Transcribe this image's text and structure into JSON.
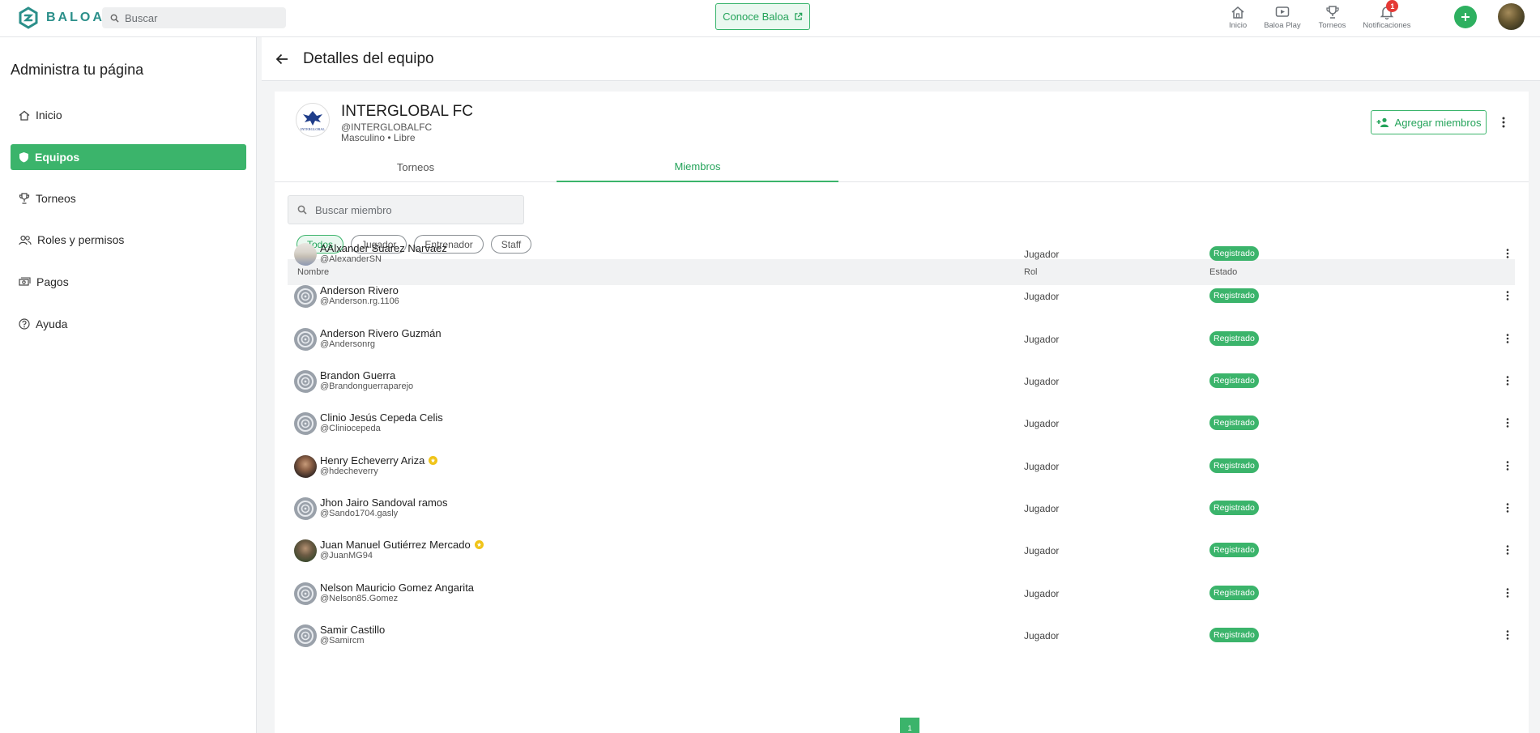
{
  "brand": {
    "name": "BALOA",
    "accent": "#3bb46b",
    "logo_color": "#2b8f8a"
  },
  "topbar": {
    "search_placeholder": "Buscar",
    "conoce_label": "Conoce Baloa",
    "nav": [
      {
        "label": "Inicio",
        "icon": "home-icon"
      },
      {
        "label": "Baloa Play",
        "icon": "play-icon"
      },
      {
        "label": "Torneos",
        "icon": "trophy-icon"
      },
      {
        "label": "Notificaciones",
        "icon": "bell-icon",
        "badge": "1"
      }
    ]
  },
  "sidebar": {
    "title": "Administra tu página",
    "items": [
      {
        "label": "Inicio",
        "icon": "home-icon",
        "active": false
      },
      {
        "label": "Equipos",
        "icon": "shield-icon",
        "active": true
      },
      {
        "label": "Torneos",
        "icon": "trophy-icon",
        "active": false
      },
      {
        "label": "Roles y permisos",
        "icon": "people-icon",
        "active": false
      },
      {
        "label": "Pagos",
        "icon": "money-icon",
        "active": false
      },
      {
        "label": "Ayuda",
        "icon": "help-icon",
        "active": false
      }
    ]
  },
  "header": {
    "title": "Detalles del equipo"
  },
  "team": {
    "name": "INTERGLOBAL FC",
    "handle": "@INTERGLOBALFC",
    "category": "Masculino • Libre",
    "logo_text": "INTERGLOBAL",
    "add_members_label": "Agregar miembros"
  },
  "tabs": [
    {
      "label": "Torneos",
      "active": false
    },
    {
      "label": "Miembros",
      "active": true
    }
  ],
  "members": {
    "search_placeholder": "Buscar miembro",
    "filters": [
      {
        "label": "Todos",
        "active": true
      },
      {
        "label": "Jugador",
        "active": false
      },
      {
        "label": "Entrenador",
        "active": false
      },
      {
        "label": "Staff",
        "active": false
      }
    ],
    "columns": {
      "name": "Nombre",
      "role": "Rol",
      "status": "Estado"
    },
    "rows": [
      {
        "name": "AAlxander Suarez Narvaez",
        "handle": "@AlexanderSN",
        "role": "Jugador",
        "status": "Registrado",
        "avatar": "photo",
        "verified": false
      },
      {
        "name": "Anderson Rivero",
        "handle": "@Anderson.rg.1106",
        "role": "Jugador",
        "status": "Registrado",
        "avatar": "default",
        "verified": false
      },
      {
        "name": "Anderson Rivero Guzmán",
        "handle": "@Andersonrg",
        "role": "Jugador",
        "status": "Registrado",
        "avatar": "default",
        "verified": false
      },
      {
        "name": "Brandon Guerra",
        "handle": "@Brandonguerraparejo",
        "role": "Jugador",
        "status": "Registrado",
        "avatar": "default",
        "verified": false
      },
      {
        "name": "Clinio Jesús Cepeda Celis",
        "handle": "@Cliniocepeda",
        "role": "Jugador",
        "status": "Registrado",
        "avatar": "default",
        "verified": false
      },
      {
        "name": "Henry Echeverry Ariza",
        "handle": "@hdecheverry",
        "role": "Jugador",
        "status": "Registrado",
        "avatar": "photo2",
        "verified": true
      },
      {
        "name": "Jhon Jairo Sandoval ramos",
        "handle": "@Sando1704.gasly",
        "role": "Jugador",
        "status": "Registrado",
        "avatar": "default",
        "verified": false
      },
      {
        "name": "Juan Manuel Gutiérrez Mercado",
        "handle": "@JuanMG94",
        "role": "Jugador",
        "status": "Registrado",
        "avatar": "photo3",
        "verified": true
      },
      {
        "name": "Nelson Mauricio Gomez Angarita",
        "handle": "@Nelson85.Gomez",
        "role": "Jugador",
        "status": "Registrado",
        "avatar": "default",
        "verified": false
      },
      {
        "name": "Samir Castillo",
        "handle": "@Samircm",
        "role": "Jugador",
        "status": "Registrado",
        "avatar": "default",
        "verified": false
      }
    ]
  },
  "pagination": {
    "current": "1"
  }
}
